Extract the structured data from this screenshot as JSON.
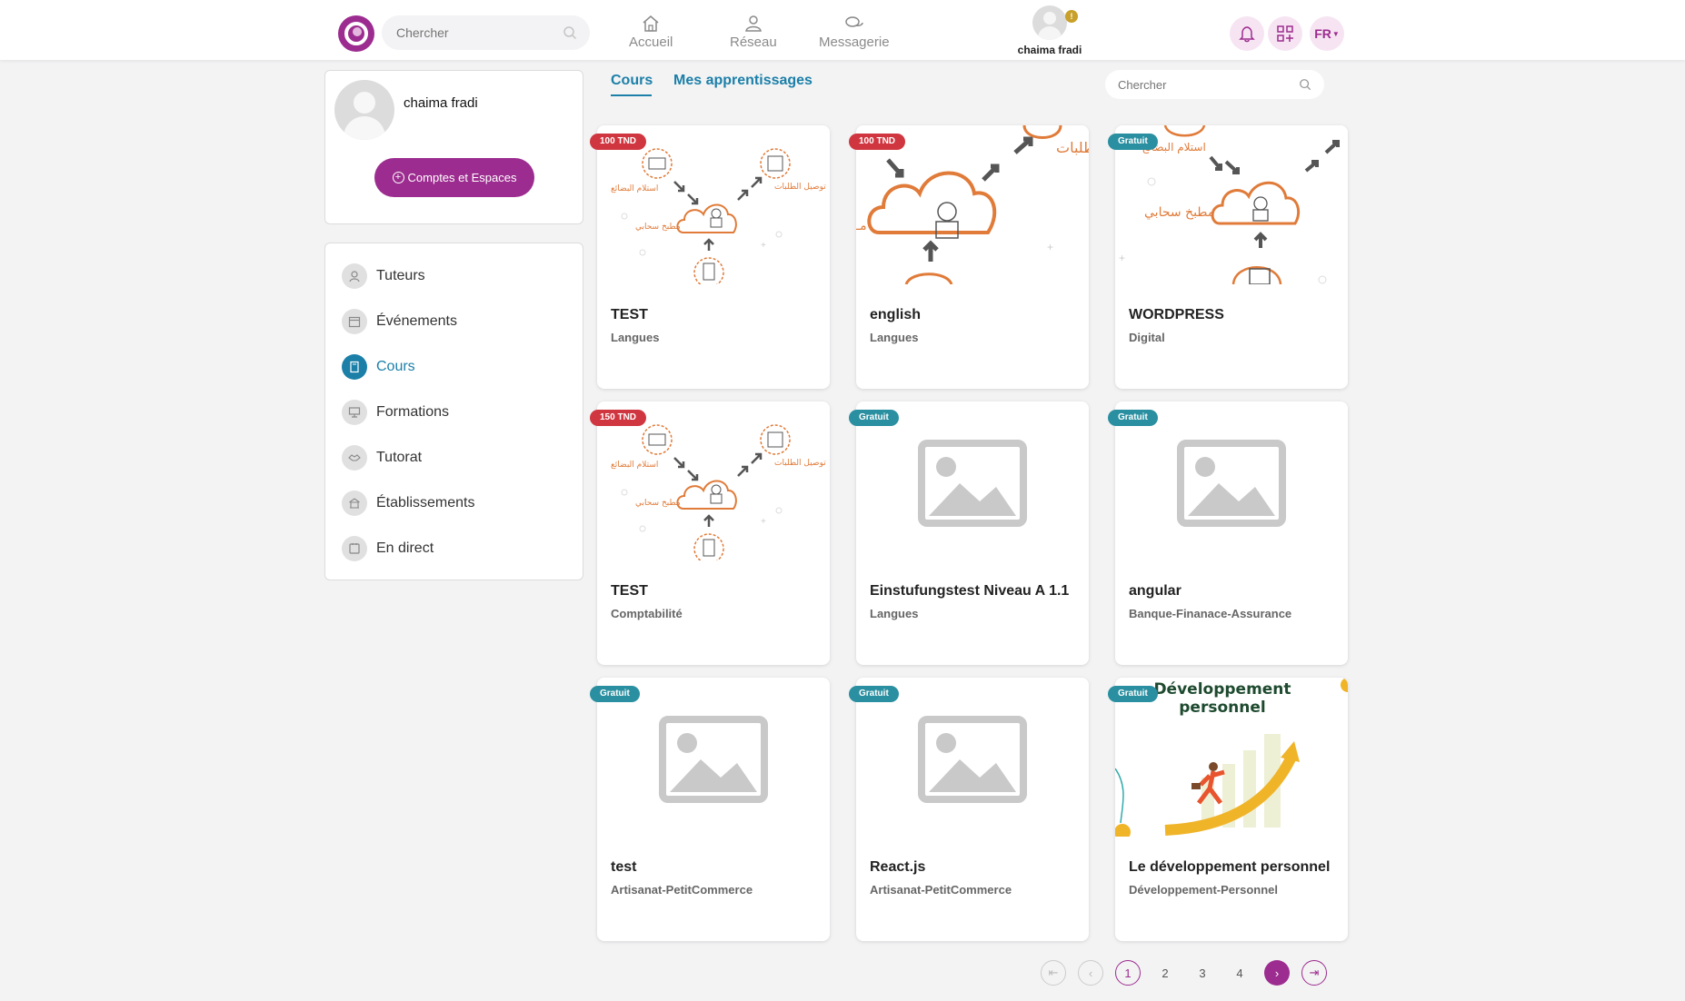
{
  "header": {
    "search_placeholder": "Chercher",
    "nav": [
      {
        "label": "Accueil",
        "icon": "home-icon"
      },
      {
        "label": "Réseau",
        "icon": "network-icon"
      },
      {
        "label": "Messagerie",
        "icon": "chat-icon"
      }
    ],
    "user_name": "chaima fradi",
    "warning_mark": "!",
    "language": "FR"
  },
  "profile_card": {
    "name": "chaima fradi",
    "accounts_button": "Comptes et Espaces"
  },
  "sidebar": {
    "items": [
      {
        "label": "Tuteurs",
        "icon": "tutor-icon",
        "active": false
      },
      {
        "label": "Événements",
        "icon": "calendar-icon",
        "active": false
      },
      {
        "label": "Cours",
        "icon": "book-icon",
        "active": true
      },
      {
        "label": "Formations",
        "icon": "presentation-icon",
        "active": false
      },
      {
        "label": "Tutorat",
        "icon": "handshake-icon",
        "active": false
      },
      {
        "label": "Établissements",
        "icon": "building-icon",
        "active": false
      },
      {
        "label": "En direct",
        "icon": "live-icon",
        "active": false
      }
    ]
  },
  "tabs": {
    "courses": "Cours",
    "my_learning": "Mes apprentissages"
  },
  "content_search_placeholder": "Chercher",
  "courses": [
    {
      "title": "TEST",
      "category": "Langues",
      "badge": "100 TND",
      "badge_type": "paid",
      "thumb": "cloud-kitchen-small"
    },
    {
      "title": "english",
      "category": "Langues",
      "badge": "100 TND",
      "badge_type": "paid",
      "thumb": "cloud-kitchen-zoom"
    },
    {
      "title": "WORDPRESS",
      "category": "Digital",
      "badge": "Gratuit",
      "badge_type": "free",
      "thumb": "cloud-kitchen-mid"
    },
    {
      "title": "TEST",
      "category": "Comptabilité",
      "badge": "150 TND",
      "badge_type": "paid",
      "thumb": "cloud-kitchen-small"
    },
    {
      "title": "Einstufungstest Niveau A 1.1",
      "category": "Langues",
      "badge": "Gratuit",
      "badge_type": "free",
      "thumb": "placeholder"
    },
    {
      "title": "angular",
      "category": "Banque-Finanace-Assurance",
      "badge": "Gratuit",
      "badge_type": "free",
      "thumb": "placeholder"
    },
    {
      "title": "test",
      "category": "Artisanat-PetitCommerce",
      "badge": "Gratuit",
      "badge_type": "free",
      "thumb": "placeholder"
    },
    {
      "title": "React.js",
      "category": "Artisanat-PetitCommerce",
      "badge": "Gratuit",
      "badge_type": "free",
      "thumb": "placeholder"
    },
    {
      "title": "Le développement personnel",
      "category": "Développement-Personnel",
      "badge": "Gratuit",
      "badge_type": "free",
      "thumb": "dev-perso"
    }
  ],
  "thumb_text": {
    "arabic_receive": "استلام البضائع",
    "arabic_deliver": "توصيل الطلبات",
    "arabic_kitchen": "مطبخ سحابي",
    "dev_perso_line1": "Développement",
    "dev_perso_line2": "personnel"
  },
  "pagination": {
    "pages": [
      "1",
      "2",
      "3",
      "4"
    ],
    "current": "1"
  },
  "colors": {
    "brand": "#9c2c8f",
    "accent": "#1b7fa8",
    "paid_badge": "#d0363f",
    "free_badge": "#2a8fa0"
  }
}
